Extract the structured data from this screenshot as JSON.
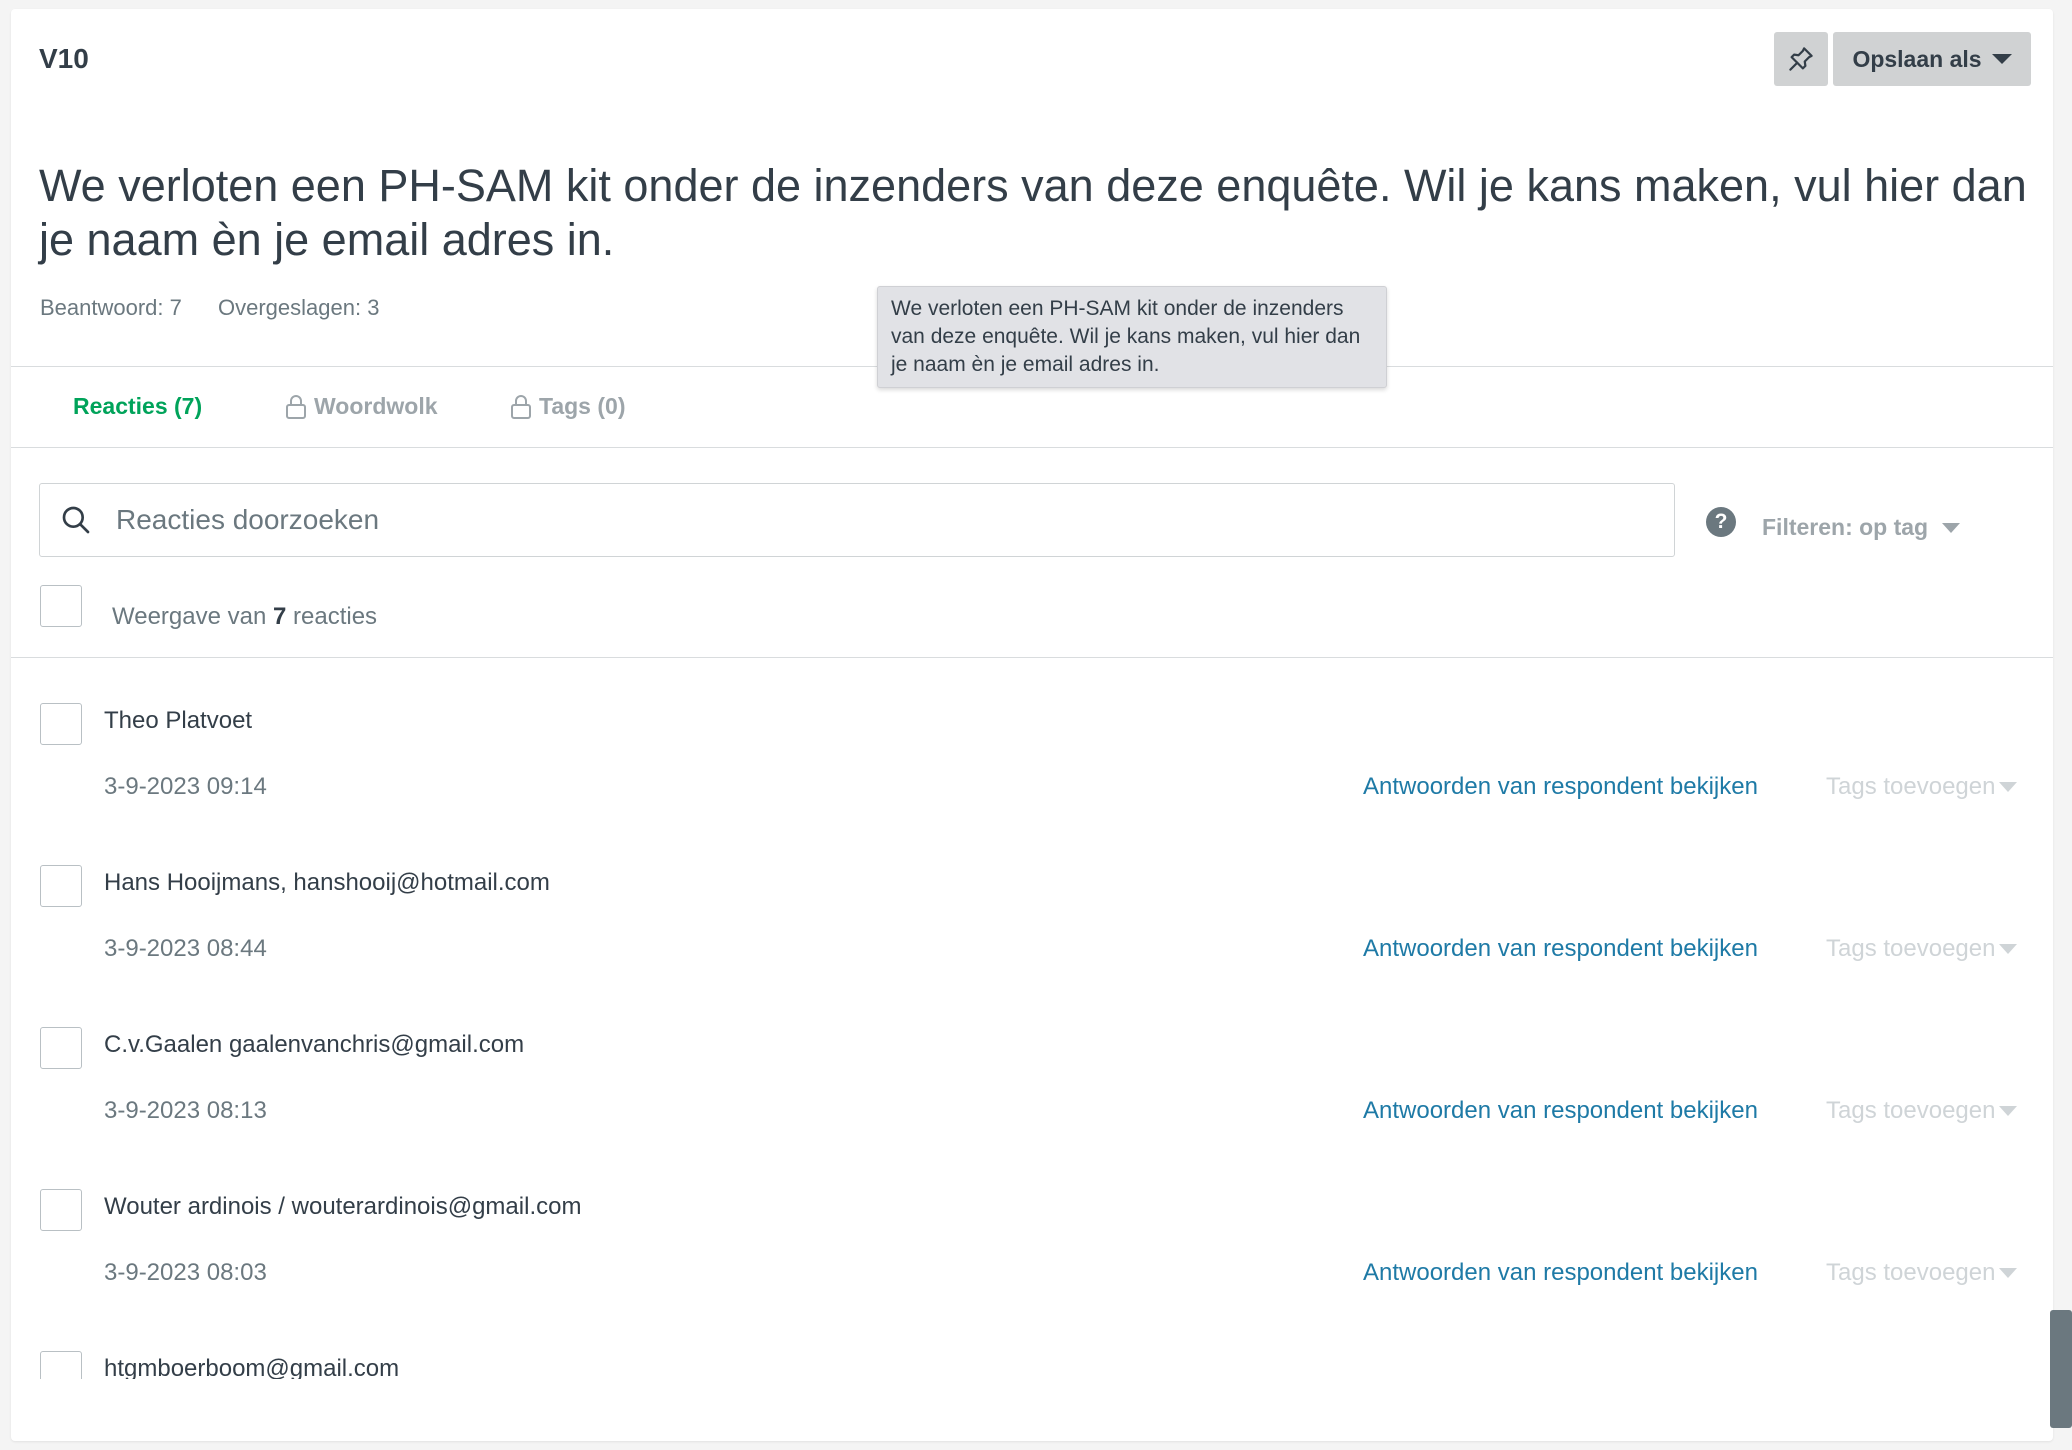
{
  "header": {
    "question_id": "V10",
    "pin_icon": "pin-icon",
    "save_label": "Opslaan als"
  },
  "question": {
    "text": "We verloten een PH-SAM kit onder de inzenders van deze enquête. Wil je kans maken, vul hier dan je naam èn je email adres in.",
    "answered": "Beantwoord: 7",
    "skipped": "Overgeslagen: 3"
  },
  "tooltip": {
    "text": "We verloten een PH-SAM kit onder de inzenders van deze enquête. Wil je kans maken, vul hier dan je naam èn je email adres in."
  },
  "tabs": [
    {
      "label": "Reacties (7)",
      "active": true,
      "locked": false
    },
    {
      "label": "Woordwolk",
      "active": false,
      "locked": true
    },
    {
      "label": "Tags (0)",
      "active": false,
      "locked": true
    }
  ],
  "search": {
    "placeholder": "Reacties doorzoeken",
    "value": ""
  },
  "filter": {
    "label": "Filteren: op tag"
  },
  "summary": {
    "prefix": "Weergave van",
    "count": "7",
    "suffix": "reacties"
  },
  "responses": [
    {
      "text": "Theo Platvoet",
      "date": "3-9-2023 09:14",
      "link": "Antwoorden van respondent bekijken",
      "tags": "Tags toevoegen"
    },
    {
      "text": "Hans Hooijmans, hanshooij@hotmail.com",
      "date": "3-9-2023 08:44",
      "link": "Antwoorden van respondent bekijken",
      "tags": "Tags toevoegen"
    },
    {
      "text": "C.v.Gaalen gaalenvanchris@gmail.com",
      "date": "3-9-2023 08:13",
      "link": "Antwoorden van respondent bekijken",
      "tags": "Tags toevoegen"
    },
    {
      "text": "Wouter ardinois / wouterardinois@gmail.com",
      "date": "3-9-2023 08:03",
      "link": "Antwoorden van respondent bekijken",
      "tags": "Tags toevoegen"
    },
    {
      "text": "htgmboerboom@gmail.com",
      "date": "",
      "link": "",
      "tags": ""
    }
  ],
  "colors": {
    "accent_green": "#00a35a",
    "link_blue": "#1e7aa6",
    "text_dark": "#333e48",
    "text_muted": "#6b787f"
  }
}
